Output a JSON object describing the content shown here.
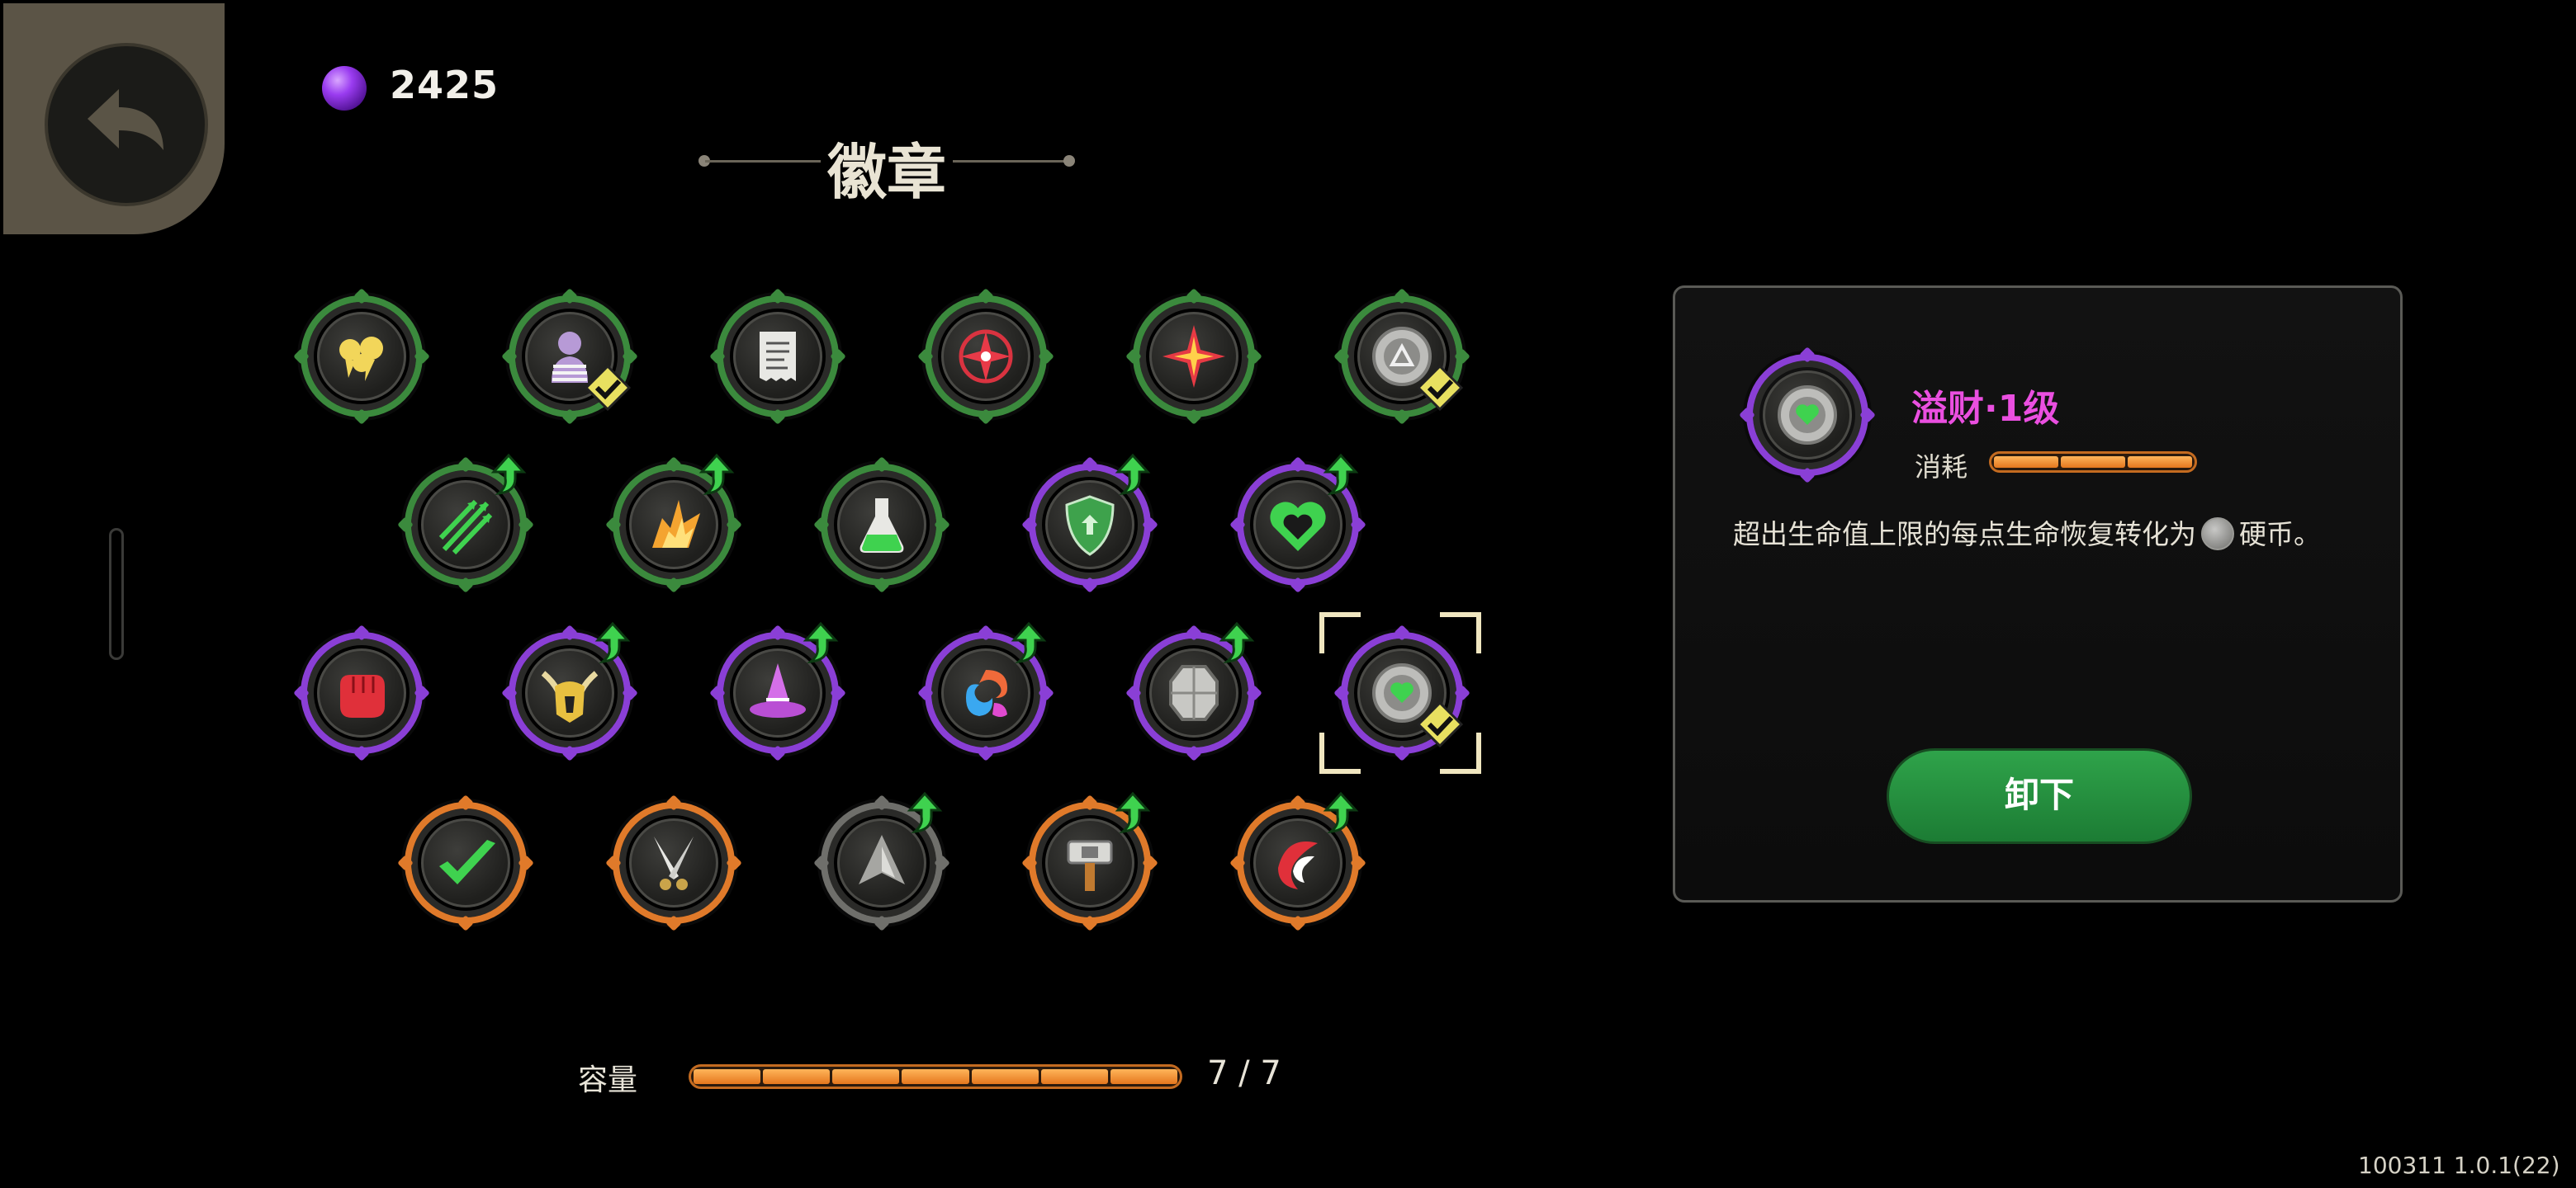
{
  "header": {
    "currency": {
      "icon": "purple-gem-icon",
      "amount": "2425"
    },
    "title": "徽章"
  },
  "badges": [
    {
      "row": 1,
      "ring": "green",
      "icon": "yellow-spirits-icon",
      "equipped": false,
      "upgradable": false
    },
    {
      "row": 1,
      "ring": "green",
      "icon": "striped-figure-icon",
      "equipped": true,
      "upgradable": false
    },
    {
      "row": 1,
      "ring": "green",
      "icon": "receipt-icon",
      "equipped": false,
      "upgradable": false
    },
    {
      "row": 1,
      "ring": "green",
      "icon": "red-compass-icon",
      "equipped": false,
      "upgradable": false
    },
    {
      "row": 1,
      "ring": "green",
      "icon": "red-star-icon",
      "equipped": false,
      "upgradable": false
    },
    {
      "row": 1,
      "ring": "green",
      "icon": "silver-coin-triangle-icon",
      "equipped": true,
      "upgradable": false
    },
    {
      "row": 2,
      "ring": "green",
      "icon": "green-arrows-icon",
      "equipped": false,
      "upgradable": true
    },
    {
      "row": 2,
      "ring": "green",
      "icon": "orange-burst-icon",
      "equipped": false,
      "upgradable": true
    },
    {
      "row": 2,
      "ring": "green",
      "icon": "green-potion-icon",
      "equipped": false,
      "upgradable": false
    },
    {
      "row": 2,
      "ring": "purple",
      "icon": "green-shield-icon",
      "equipped": false,
      "upgradable": true
    },
    {
      "row": 2,
      "ring": "purple",
      "icon": "green-heart-icon",
      "equipped": false,
      "upgradable": true
    },
    {
      "row": 3,
      "ring": "purple",
      "icon": "red-fist-icon",
      "equipped": false,
      "upgradable": false
    },
    {
      "row": 3,
      "ring": "purple",
      "icon": "horned-helmet-icon",
      "equipped": false,
      "upgradable": true
    },
    {
      "row": 3,
      "ring": "purple",
      "icon": "witch-hat-icon",
      "equipped": false,
      "upgradable": true
    },
    {
      "row": 3,
      "ring": "purple",
      "icon": "swirl-icon",
      "equipped": false,
      "upgradable": true
    },
    {
      "row": 3,
      "ring": "purple",
      "icon": "gray-crystal-icon",
      "equipped": false,
      "upgradable": true
    },
    {
      "row": 3,
      "ring": "purple",
      "icon": "silver-coin-heart-icon",
      "equipped": true,
      "upgradable": false,
      "selected": true
    },
    {
      "row": 4,
      "ring": "orange",
      "icon": "green-check-icon",
      "equipped": false,
      "upgradable": false
    },
    {
      "row": 4,
      "ring": "orange",
      "icon": "crossed-daggers-icon",
      "equipped": false,
      "upgradable": false
    },
    {
      "row": 4,
      "ring": "gray",
      "icon": "gray-arrow-up-icon",
      "equipped": false,
      "upgradable": true
    },
    {
      "row": 4,
      "ring": "orange",
      "icon": "hammer-icon",
      "equipped": false,
      "upgradable": true
    },
    {
      "row": 4,
      "ring": "orange",
      "icon": "red-crest-icon",
      "equipped": false,
      "upgradable": true
    }
  ],
  "capacity": {
    "label": "容量",
    "used": 7,
    "total": 7,
    "value_text": "7 / 7"
  },
  "detail": {
    "name": "溢财·1级",
    "cost_label": "消耗",
    "cost_segments_filled": 3,
    "cost_segments_total": 3,
    "description_before": "超出生命值上限的每点生命恢复转化为",
    "description_after": "硬币。",
    "button_label": "卸下"
  },
  "version": "100311 1.0.1(22)",
  "colors": {
    "green_ring": "#3b8a3d",
    "purple_ring": "#8a3fd6",
    "orange_ring": "#e07a2a",
    "name_pink": "#ea4fe0",
    "button_green": "#2fa34a"
  }
}
